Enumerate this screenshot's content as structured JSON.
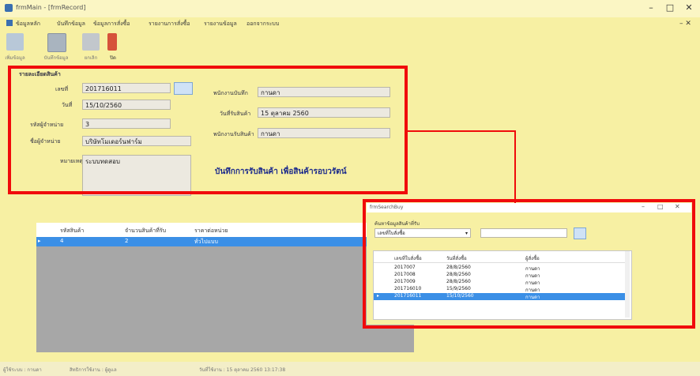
{
  "window": {
    "title": "frmMain - [frmRecord]"
  },
  "menu": [
    "ข้อมูลหลัก",
    "บันทึกข้อมูล",
    "ข้อมูลการสั่งซื้อ",
    "รายงานการสั่งซื้อ",
    "รายงานข้อมูล",
    "ออกจากระบบ"
  ],
  "toolbar": [
    {
      "label": "เพิ่มข้อมูล",
      "icon": "add-icon"
    },
    {
      "label": "บันทึกข้อมูล",
      "icon": "save-icon"
    },
    {
      "label": "ยกเลิก",
      "icon": "cancel-icon"
    },
    {
      "label": "ปิด",
      "icon": "exit-icon"
    }
  ],
  "form": {
    "group_title": "รายละเอียดสินค้า",
    "no_label": "เลขที่",
    "no_value": "201716011",
    "date_label": "วันที่",
    "date_value": "15/10/2560",
    "partner_id_label": "รหัสผู้จำหน่าย",
    "partner_id_value": "3",
    "partner_name_label": "ชื่อผู้จำหน่าย",
    "partner_name_value": "บริษัทโมเดอร์นฟาร์ม",
    "note_label": "หมายเหตุ",
    "note_value": "ระบบทดสอบ",
    "recorder_label": "พนักงานบันทึก",
    "recorder_value": "กานดา",
    "receive_date_label": "วันที่รับสินค้า",
    "receive_date_value": "15 ตุลาคม 2560",
    "receiver_label": "พนักงานรับสินค้า",
    "receiver_value": "กานดา",
    "headline": "บันทึกการรับสินค้า เพื่อสินค้ารอบวรัตน์"
  },
  "main_grid": {
    "columns": [
      "รหัสสินค้า",
      "จำนวนสินค้าที่รับ",
      "ราคาต่อหน่วย"
    ],
    "rows": [
      [
        "4",
        "2",
        "ทั่วไปแบบ"
      ]
    ]
  },
  "search_window": {
    "title": "frmSearchBuy",
    "label": "ค้นหาข้อมูลสินค้าที่รับ",
    "combo_value": "เลขที่ใบสั่งซื้อ",
    "columns": [
      "เลขที่ใบสั่งซื้อ",
      "วันที่สั่งซื้อ",
      "ผู้สั่งซื้อ"
    ],
    "rows": [
      [
        "2017007",
        "28/8/2560",
        "กานดา"
      ],
      [
        "2017008",
        "28/8/2560",
        "กานดา"
      ],
      [
        "2017009",
        "28/8/2560",
        "กานดา"
      ],
      [
        "201716010",
        "15/9/2560",
        "กานดา"
      ],
      [
        "201716011",
        "15/10/2560",
        "กานดา"
      ]
    ]
  },
  "status": {
    "user": "ผู้ใช้ระบบ : กานดา",
    "role": "สิทธิการใช้งาน : ผู้ดูแล",
    "date": "วันที่ใช้งาน : 15 ตุลาคม 2560 13:17:38"
  },
  "colors": {
    "highlight": "#f00b0b",
    "selection": "#3b8fe6",
    "background": "#f7f0a3"
  }
}
